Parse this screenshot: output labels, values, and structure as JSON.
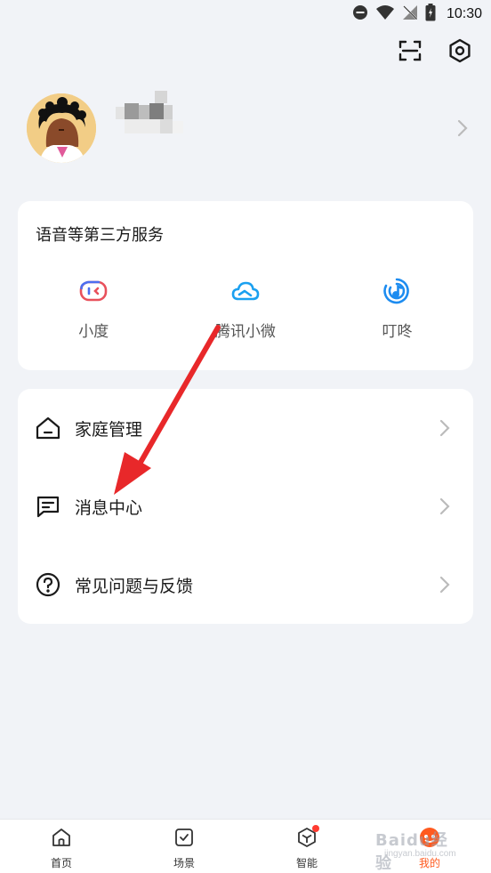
{
  "status_bar": {
    "time": "10:30",
    "icons": [
      "dnd-icon",
      "wifi-icon",
      "no-signal-icon",
      "battery-icon"
    ]
  },
  "top_actions": {
    "icons": [
      "scan-icon",
      "settings-icon"
    ]
  },
  "profile": {
    "avatar": "avatar-cartoon",
    "username_blurred": true
  },
  "services": {
    "title": "语音等第三方服务",
    "items": [
      {
        "label": "小度",
        "icon": "xiaodu-icon",
        "color": "#e8505b"
      },
      {
        "label": "腾讯小微",
        "icon": "cloud-icon",
        "color": "#1aa0f0"
      },
      {
        "label": "叮咚",
        "icon": "dingdong-icon",
        "color": "#1d8cf0"
      }
    ]
  },
  "menu": {
    "items": [
      {
        "label": "家庭管理",
        "icon": "home-icon"
      },
      {
        "label": "消息中心",
        "icon": "message-icon"
      },
      {
        "label": "常见问题与反馈",
        "icon": "help-icon"
      }
    ]
  },
  "tab_bar": {
    "tabs": [
      {
        "label": "首页",
        "icon": "home-tab-icon",
        "active": false
      },
      {
        "label": "场景",
        "icon": "scene-tab-icon",
        "active": false
      },
      {
        "label": "智能",
        "icon": "smart-tab-icon",
        "active": false,
        "badge": true
      },
      {
        "label": "我的",
        "icon": "me-tab-icon",
        "active": true
      }
    ]
  },
  "watermark": {
    "text": "Baidu经验",
    "sub": "jingyan.baidu.com"
  },
  "colors": {
    "accent": "#ff5a1f",
    "arrow": "#e8282a",
    "background": "#f1f3f7"
  }
}
